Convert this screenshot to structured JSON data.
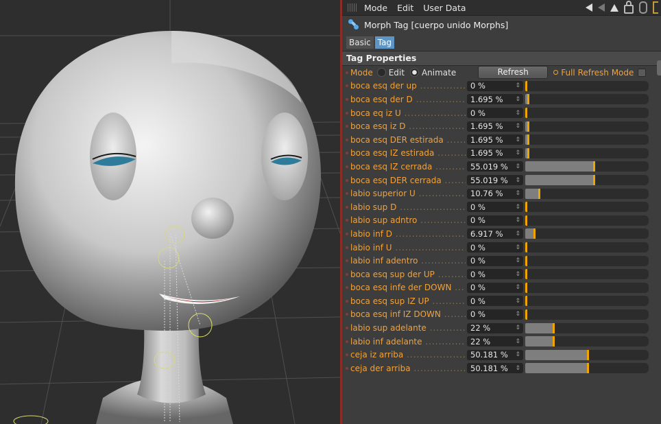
{
  "menubar": {
    "items": [
      "Mode",
      "Edit",
      "User Data"
    ],
    "right_icons": [
      "back-arrow-icon",
      "forward-arrow-icon",
      "up-arrow-icon",
      "lock-icon",
      "chain-icon",
      "new-panel-icon"
    ]
  },
  "object": {
    "title": "Morph Tag [cuerpo unido Morphs]",
    "icon": "morph-tag-icon"
  },
  "tabs": [
    {
      "label": "Basic",
      "active": false
    },
    {
      "label": "Tag",
      "active": true
    }
  ],
  "section_title": "Tag Properties",
  "mode": {
    "label": "Mode",
    "options": [
      {
        "label": "Edit",
        "selected": false
      },
      {
        "label": "Animate",
        "selected": true
      }
    ],
    "refresh_button": "Refresh",
    "full_refresh_label": "Full Refresh Mode",
    "full_refresh_checked": false
  },
  "colors": {
    "accent_label": "#f2a23a",
    "slider_handle": "#f0a400",
    "active_tab": "#5f95c5",
    "splitter": "#8a2e25"
  },
  "morphs": [
    {
      "label": "boca esq der up",
      "value": "0 %",
      "strength": 0
    },
    {
      "label": "boca esq der D",
      "value": "1.695 %",
      "strength": 1.695
    },
    {
      "label": "boca eq iz U",
      "value": "0 %",
      "strength": 0
    },
    {
      "label": "boca esq iz D",
      "value": "1.695 %",
      "strength": 1.695
    },
    {
      "label": "boca esq DER estirada",
      "value": "1.695 %",
      "strength": 1.695
    },
    {
      "label": "boca esq IZ estirada",
      "value": "1.695 %",
      "strength": 1.695
    },
    {
      "label": "boca esq IZ cerrada",
      "value": "55.019 %",
      "strength": 55.019
    },
    {
      "label": "boca esq DER cerrada",
      "value": "55.019 %",
      "strength": 55.019
    },
    {
      "label": "labio superior U",
      "value": "10.76 %",
      "strength": 10.76
    },
    {
      "label": "labio sup D",
      "value": "0 %",
      "strength": 0
    },
    {
      "label": "labio sup adntro",
      "value": "0 %",
      "strength": 0
    },
    {
      "label": "labio inf D",
      "value": "6.917 %",
      "strength": 6.917
    },
    {
      "label": "labio inf U",
      "value": "0 %",
      "strength": 0
    },
    {
      "label": "labio inf adentro",
      "value": "0 %",
      "strength": 0
    },
    {
      "label": "boca esq sup der UP",
      "value": "0 %",
      "strength": 0
    },
    {
      "label": "boca esq infe der DOWN",
      "value": "0 %",
      "strength": 0
    },
    {
      "label": "boca esq sup IZ UP",
      "value": "0 %",
      "strength": 0
    },
    {
      "label": "boca esq inf IZ DOWN",
      "value": "0 %",
      "strength": 0
    },
    {
      "label": "labio sup adelante",
      "value": "22 %",
      "strength": 22
    },
    {
      "label": "labio inf adelante",
      "value": "22 %",
      "strength": 22
    },
    {
      "label": "ceja iz arriba",
      "value": "50.181 %",
      "strength": 50.181
    },
    {
      "label": "ceja der arriba",
      "value": "50.181 %",
      "strength": 50.181
    }
  ]
}
